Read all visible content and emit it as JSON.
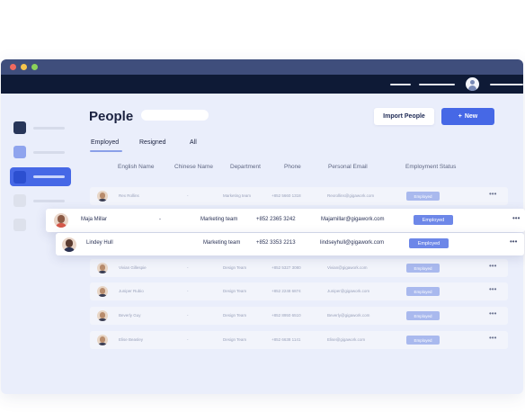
{
  "window": {
    "brand_dark": "#0e1a36",
    "titlebar": "#3f4e7c",
    "accent": "#4668e6"
  },
  "header": {
    "title": "People",
    "import_label": "Import People",
    "new_label": "New",
    "new_icon": "+"
  },
  "tabs": [
    {
      "label": "Employed",
      "active": true
    },
    {
      "label": "Resigned",
      "active": false
    },
    {
      "label": "All",
      "active": false
    }
  ],
  "columns": [
    "English Name",
    "Chinese Name",
    "Department",
    "Phone",
    "Personal Email",
    "Employment Status"
  ],
  "rows": [
    {
      "name": "Rex Rollins",
      "chinese": "-",
      "dept": "Marketing team",
      "phone": "+852 5660 1318",
      "email": "Rexrollins@gigawork.com",
      "status": "Employed"
    },
    {
      "name": "Maja Millar",
      "chinese": "-",
      "dept": "Marketing team",
      "phone": "+852 2365 3242",
      "email": "Majamillar@gigawork.com",
      "status": "Employed"
    },
    {
      "name": "Lindey Hull",
      "chinese": "",
      "dept": "Marketing team",
      "phone": "+852 3353 2213",
      "email": "lindseyhull@gigawork.com",
      "status": "Employed"
    },
    {
      "name": "Vivian Gillespie",
      "chinese": "-",
      "dept": "Design Team",
      "phone": "+852 5327 3080",
      "email": "Vivian@gigawork.com",
      "status": "Employed"
    },
    {
      "name": "Juniper Rubio",
      "chinese": "-",
      "dept": "Design Team",
      "phone": "+852 2248 6874",
      "email": "Juniper@gigawork.com",
      "status": "Employed"
    },
    {
      "name": "Beverly Guy",
      "chinese": "-",
      "dept": "Design Team",
      "phone": "+852 8950 6510",
      "email": "Beverly@gigawork.com",
      "status": "Employed"
    },
    {
      "name": "Elise Beasley",
      "chinese": "-",
      "dept": "Design Team",
      "phone": "+852 6638 1141",
      "email": "Elise@gigawork.com",
      "status": "Employed"
    }
  ],
  "more_icon": "•••"
}
